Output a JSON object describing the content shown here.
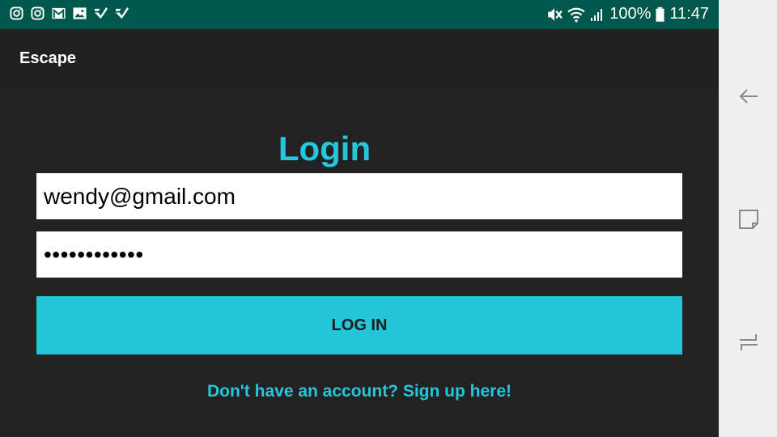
{
  "status_bar": {
    "notification_icons": [
      "instagram-icon",
      "instagram-icon",
      "gmail-icon",
      "gallery-icon",
      "check-app-icon",
      "check-app-icon"
    ],
    "battery": "100%",
    "time": "11:47",
    "system_icons": [
      "mute-icon",
      "wifi-icon",
      "signal-icon",
      "battery-icon"
    ]
  },
  "app_bar": {
    "title": "Escape"
  },
  "login": {
    "title": "Login",
    "email_value": "wendy@gmail.com",
    "password_value": "••••••••••••",
    "login_button": "LOG IN",
    "signup_link": "Don't have an account? Sign up here!"
  },
  "nav_bar": {
    "buttons": [
      "back-icon",
      "recents-icon",
      "switch-icon"
    ]
  },
  "colors": {
    "accent": "#26c6da",
    "status_bar": "#00574b",
    "background": "#212121"
  }
}
